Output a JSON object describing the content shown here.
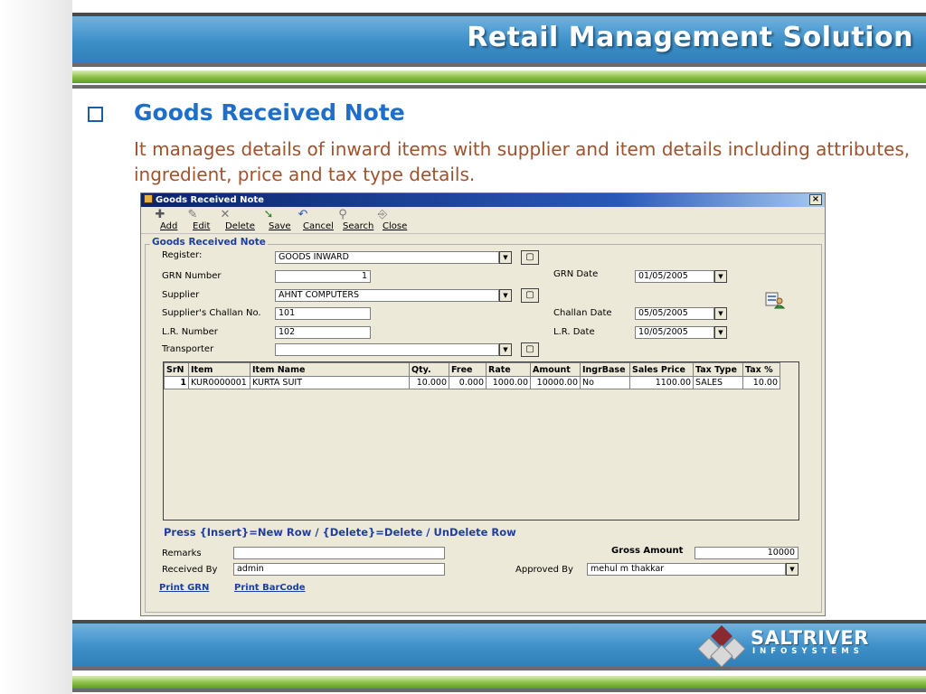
{
  "slide": {
    "header_title": "Retail Management Solution",
    "title": "Goods Received Note",
    "description": "It manages details of inward items with supplier and item details including attributes, ingredient, price and tax type details."
  },
  "window": {
    "title": "Goods Received Note",
    "close_label": "×"
  },
  "toolbar": {
    "add": "Add",
    "edit": "Edit",
    "delete": "Delete",
    "save": "Save",
    "cancel": "Cancel",
    "search": "Search",
    "close": "Close"
  },
  "form": {
    "group_title": "Goods Received Note",
    "register_label": "Register:",
    "register_value": "GOODS INWARD",
    "grn_number_label": "GRN Number",
    "grn_number_value": "1",
    "grn_date_label": "GRN Date",
    "grn_date_value": "01/05/2005",
    "supplier_label": "Supplier",
    "supplier_value": "AHNT COMPUTERS",
    "challan_no_label": "Supplier's Challan No.",
    "challan_no_value": "101",
    "challan_date_label": "Challan Date",
    "challan_date_value": "05/05/2005",
    "lr_number_label": "L.R. Number",
    "lr_number_value": "102",
    "lr_date_label": "L.R. Date",
    "lr_date_value": "10/05/2005",
    "transporter_label": "Transporter",
    "transporter_value": ""
  },
  "grid": {
    "columns": [
      "SrN",
      "Item",
      "Item Name",
      "Qty.",
      "Free",
      "Rate",
      "Amount",
      "IngrBase",
      "Sales Price",
      "Tax Type",
      "Tax %"
    ],
    "rows": [
      [
        "1",
        "KUR0000001",
        "KURTA SUIT",
        "10.000",
        "0.000",
        "1000.00",
        "10000.00",
        "No",
        "1100.00",
        "SALES",
        "10.00"
      ]
    ]
  },
  "hint": "Press {Insert}=New Row / {Delete}=Delete / UnDelete Row",
  "footer_form": {
    "remarks_label": "Remarks",
    "remarks_value": "",
    "received_by_label": "Received By",
    "received_by_value": "admin",
    "gross_amount_label": "Gross Amount",
    "gross_amount_value": "10000",
    "approved_by_label": "Approved  By",
    "approved_by_value": "mehul m thakkar",
    "print_grn": "Print GRN",
    "print_barcode": "Print BarCode"
  },
  "brand": {
    "name": "SALTRIVER",
    "sub": "INFOSYSTEMS"
  },
  "colors": {
    "title_blue": "#1f6fc9",
    "desc_brown": "#a0522d",
    "band_blue": "#3d8fc8",
    "band_green": "#8fc34a",
    "window_bg": "#ece9d8",
    "label_blue": "#1f3e9e"
  }
}
